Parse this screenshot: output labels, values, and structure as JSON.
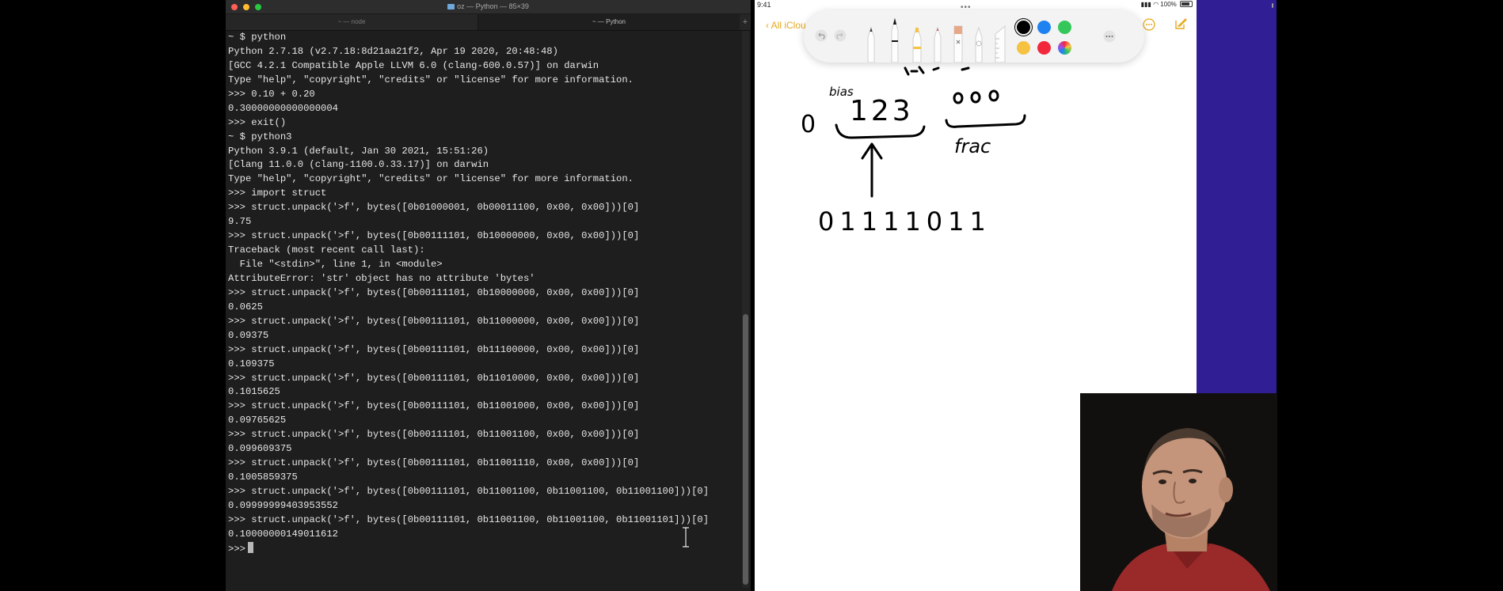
{
  "terminal": {
    "window_title": "oz — Python — 85×39",
    "tabs": [
      {
        "label": "~ — node"
      },
      {
        "label": "~ — Python"
      }
    ],
    "new_tab_label": "+",
    "lines": [
      "~ $ python",
      "Python 2.7.18 (v2.7.18:8d21aa21f2, Apr 19 2020, 20:48:48)",
      "[GCC 4.2.1 Compatible Apple LLVM 6.0 (clang-600.0.57)] on darwin",
      "Type \"help\", \"copyright\", \"credits\" or \"license\" for more information.",
      ">>> 0.10 + 0.20",
      "0.30000000000000004",
      ">>> exit()",
      "~ $ python3",
      "Python 3.9.1 (default, Jan 30 2021, 15:51:26)",
      "[Clang 11.0.0 (clang-1100.0.33.17)] on darwin",
      "Type \"help\", \"copyright\", \"credits\" or \"license\" for more information.",
      ">>> import struct",
      ">>> struct.unpack('>f', bytes([0b01000001, 0b00011100, 0x00, 0x00]))[0]",
      "9.75",
      ">>> struct.unpack('>f', bytes([0b00111101, 0b10000000, 0x00, 0x00]))[0]",
      "Traceback (most recent call last):",
      "  File \"<stdin>\", line 1, in <module>",
      "AttributeError: 'str' object has no attribute 'bytes'",
      ">>> struct.unpack('>f', bytes([0b00111101, 0b10000000, 0x00, 0x00]))[0]",
      "0.0625",
      ">>> struct.unpack('>f', bytes([0b00111101, 0b11000000, 0x00, 0x00]))[0]",
      "0.09375",
      ">>> struct.unpack('>f', bytes([0b00111101, 0b11100000, 0x00, 0x00]))[0]",
      "0.109375",
      ">>> struct.unpack('>f', bytes([0b00111101, 0b11010000, 0x00, 0x00]))[0]",
      "0.1015625",
      ">>> struct.unpack('>f', bytes([0b00111101, 0b11001000, 0x00, 0x00]))[0]",
      "0.09765625",
      ">>> struct.unpack('>f', bytes([0b00111101, 0b11001100, 0x00, 0x00]))[0]",
      "0.099609375",
      ">>> struct.unpack('>f', bytes([0b00111101, 0b11001110, 0x00, 0x00]))[0]",
      "0.1005859375",
      ">>> struct.unpack('>f', bytes([0b00111101, 0b11001100, 0b11001100, 0b11001100]))[0]",
      "0.09999999403953552",
      ">>> struct.unpack('>f', bytes([0b00111101, 0b11001100, 0b11001100, 0b11001101]))[0]",
      "0.10000000149011612"
    ],
    "prompt": ">>>"
  },
  "notes": {
    "status_time": "9:41",
    "status_battery": "100%",
    "back_label": "All iClou",
    "colors": {
      "black": "#000000",
      "blue": "#1e82f0",
      "green": "#34c759",
      "yellow": "#f5c242",
      "red": "#f2293d"
    },
    "handwriting": {
      "bias_label": "bias",
      "exponent_digits": "123",
      "frac_label": "frac",
      "sign_digit": "0",
      "binary_digits": "01111011"
    }
  },
  "webcam": {
    "description_icon": "presenter-video"
  }
}
